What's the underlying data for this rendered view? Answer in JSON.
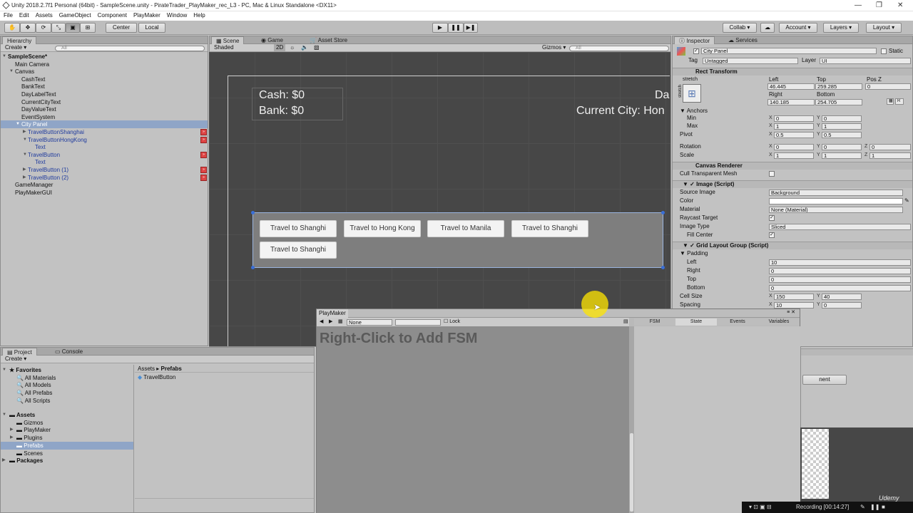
{
  "window": {
    "title": "Unity 2018.2.7f1 Personal (64bit) - SampleScene.unity - PirateTrader_PlayMaker_rec_L3 - PC, Mac & Linux Standalone <DX11>",
    "min": "—",
    "max": "❐",
    "close": "✕"
  },
  "menu": [
    "File",
    "Edit",
    "Assets",
    "GameObject",
    "Component",
    "PlayMaker",
    "Window",
    "Help"
  ],
  "toolbar": {
    "center": "Center",
    "local": "Local",
    "collab": "Collab ▾",
    "account": "Account ▾",
    "layers": "Layers ▾",
    "layout": "Layout ▾"
  },
  "hierarchy": {
    "tab": "Hierarchy",
    "create": "Create ▾",
    "search_placeholder": "All",
    "items": [
      "SampleScene*",
      "Main Camera",
      "Canvas",
      "CashText",
      "BankText",
      "DayLabelText",
      "CurrentCityText",
      "DayValueText",
      "EventSystem",
      "City Panel",
      "TravelButtonShanghai",
      "TravelButtonHongKong",
      "Text",
      "TravelButton",
      "Text",
      "TravelButton (1)",
      "TravelButton (2)",
      "GameManager",
      "PlayMakerGUI"
    ]
  },
  "scene": {
    "tabs": [
      "Scene",
      "Game",
      "Asset Store"
    ],
    "shaded": "Shaded",
    "mode_2d": "2D",
    "gizmos": "Gizmos ▾",
    "search_placeholder": "All",
    "cash": "Cash: $0",
    "bank": "Bank: $0",
    "day": "Da",
    "city": "Current City: Hon",
    "buttons": [
      "Travel to Shanghi",
      "Travel to Hong Kong",
      "Travel to Manila",
      "Travel to Shanghi",
      "Travel to Shanghi"
    ]
  },
  "inspector": {
    "tabs": [
      "Inspector",
      "Services"
    ],
    "object_name": "City Panel",
    "static": "Static",
    "tag_label": "Tag",
    "tag_value": "Untagged",
    "layer_label": "Layer",
    "layer_value": "UI",
    "rect_transform": "Rect Transform",
    "stretch": "stretch",
    "stretch_side": "stretch",
    "col_left": "Left",
    "col_top": "Top",
    "col_posz": "Pos Z",
    "left": "46.445",
    "top": "259.285",
    "posz": "0",
    "col_right": "Right",
    "col_bottom": "Bottom",
    "right": "140.185",
    "bottom": "254.705",
    "btn_r": "R",
    "anchors": "Anchors",
    "min": "Min",
    "max": "Max",
    "min_x": "0",
    "min_y": "0",
    "max_x": "1",
    "max_y": "1",
    "pivot": "Pivot",
    "pivot_x": "0.5",
    "pivot_y": "0.5",
    "rotation": "Rotation",
    "rot_x": "0",
    "rot_y": "0",
    "rot_z": "0",
    "scale": "Scale",
    "scale_x": "1",
    "scale_y": "1",
    "scale_z": "1",
    "canvas_renderer": "Canvas Renderer",
    "cull": "Cull Transparent Mesh",
    "image_script": "Image (Script)",
    "source_image": "Source Image",
    "source_image_value": "Background",
    "color": "Color",
    "material": "Material",
    "material_value": "None (Material)",
    "raycast": "Raycast Target",
    "image_type": "Image Type",
    "image_type_value": "Sliced",
    "fill_center": "Fill Center",
    "grid_layout": "Grid Layout Group (Script)",
    "padding": "Padding",
    "pad_left": "Left",
    "pad_left_v": "10",
    "pad_right": "Right",
    "pad_right_v": "0",
    "pad_top": "Top",
    "pad_top_v": "0",
    "pad_bottom": "Bottom",
    "pad_bottom_v": "0",
    "cell_size": "Cell Size",
    "cell_x": "150",
    "cell_y": "40",
    "spacing": "Spacing",
    "spacing_x": "10",
    "spacing_y": "0",
    "add_component_fragment": "nent",
    "x": "X",
    "y": "Y",
    "z": "Z"
  },
  "playmaker": {
    "title": "PlayMaker",
    "none": "None",
    "lock": "Lock",
    "hint": "Right-Click to Add FSM",
    "tabs": [
      "FSM",
      "State",
      "Events",
      "Variables"
    ]
  },
  "project": {
    "tabs": [
      "Project",
      "Console"
    ],
    "create": "Create ▾",
    "favorites": "Favorites",
    "fav_items": [
      "All Materials",
      "All Models",
      "All Prefabs",
      "All Scripts"
    ],
    "assets": "Assets",
    "asset_items": [
      "Gizmos",
      "PlayMaker",
      "Plugins",
      "Prefabs",
      "Scenes"
    ],
    "packages": "Packages",
    "breadcrumb_root": "Assets",
    "breadcrumb_sep": "▸",
    "breadcrumb_leaf": "Prefabs",
    "prefab": "TravelButton"
  },
  "status": {
    "recording": "Recording [00:14:27]",
    "watermark": "Udemy"
  }
}
